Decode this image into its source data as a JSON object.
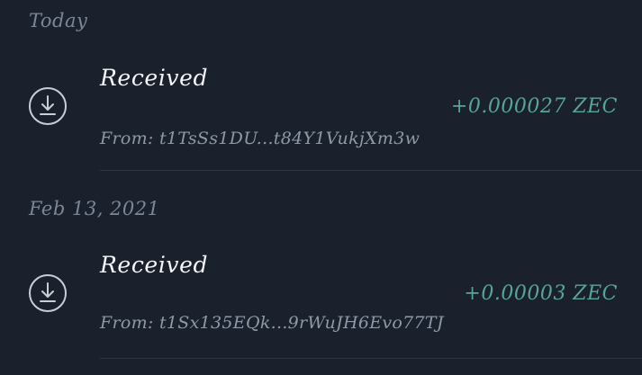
{
  "groups": [
    {
      "date_label": "Today",
      "transactions": [
        {
          "icon": "download-icon",
          "title": "Received",
          "from": "From: t1TsSs1DU...t84Y1VukjXm3w",
          "amount": "+0.000027 ZEC"
        }
      ]
    },
    {
      "date_label": "Feb 13, 2021",
      "transactions": [
        {
          "icon": "download-icon",
          "title": "Received",
          "from": "From: t1Sx135EQk...9rWuJH6Evo77TJ",
          "amount": "+0.00003 ZEC"
        }
      ]
    }
  ],
  "colors": {
    "background": "#1a212c",
    "amount_positive": "#57a59a",
    "secondary_text": "#8e99a7",
    "primary_text": "#f4f6f8"
  }
}
